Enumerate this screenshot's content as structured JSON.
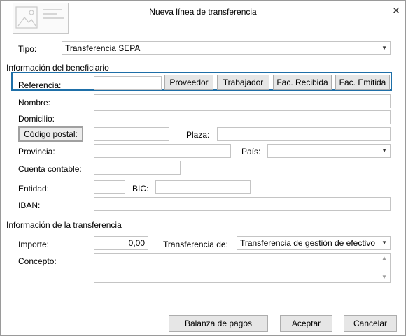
{
  "window": {
    "title": "Nueva línea de transferencia",
    "close_glyph": "✕"
  },
  "tipo": {
    "label": "Tipo:",
    "value": "Transferencia SEPA"
  },
  "beneficiario": {
    "section_title": "Información del beneficiario",
    "referencia_label": "Referencia:",
    "referencia_value": "",
    "buttons": {
      "proveedor": "Proveedor",
      "trabajador": "Trabajador",
      "fac_recibida": "Fac. Recibida",
      "fac_emitida": "Fac. Emitida"
    },
    "nombre_label": "Nombre:",
    "nombre_value": "",
    "domicilio_label": "Domicilio:",
    "domicilio_value": "",
    "codigo_postal_button": "Código postal:",
    "codigo_postal_value": "",
    "plaza_label": "Plaza:",
    "plaza_value": "",
    "provincia_label": "Provincia:",
    "provincia_value": "",
    "pais_label": "País:",
    "pais_value": "",
    "cuenta_contable_label": "Cuenta contable:",
    "cuenta_contable_value": "",
    "entidad_label": "Entidad:",
    "entidad_value": "",
    "bic_label": "BIC:",
    "bic_value": "",
    "iban_label": "IBAN:",
    "iban_value": ""
  },
  "transferencia": {
    "section_title": "Información de la transferencia",
    "importe_label": "Importe:",
    "importe_value": "0,00",
    "transferencia_de_label": "Transferencia de:",
    "transferencia_de_value": "Transferencia de gestión de efectivo",
    "concepto_label": "Concepto:",
    "concepto_value": ""
  },
  "footer": {
    "balanza_button": "Balanza de pagos",
    "aceptar_button": "Aceptar",
    "cancelar_button": "Cancelar"
  },
  "colors": {
    "highlight_border": "#1e6fa8"
  }
}
